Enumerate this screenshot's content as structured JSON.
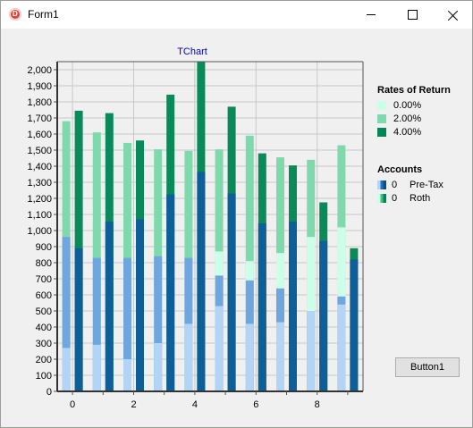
{
  "window": {
    "title": "Form1"
  },
  "button": {
    "label": "Button1"
  },
  "chart_title": "TChart",
  "legends": {
    "rates": {
      "title": "Rates of Return",
      "items": [
        {
          "label": "0.00%",
          "color": "#ccffe8"
        },
        {
          "label": "2.00%",
          "color": "#7fd9ad"
        },
        {
          "label": "4.00%",
          "color": "#008557"
        }
      ]
    },
    "accounts": {
      "title": "Accounts",
      "items": [
        {
          "value": "0",
          "label": "Pre-Tax",
          "colors": [
            "#b3d4f5",
            "#1c74c0",
            "#0a4e86"
          ]
        },
        {
          "value": "0",
          "label": "Roth",
          "colors": [
            "#ccffe8",
            "#3fbf86",
            "#008557"
          ]
        }
      ]
    }
  },
  "chart_data": {
    "type": "bar",
    "title": "TChart",
    "x": [
      0,
      1,
      2,
      3,
      4,
      5,
      6,
      7,
      8,
      9
    ],
    "x_ticks": [
      "0",
      "2",
      "4",
      "6",
      "8"
    ],
    "ylim": [
      0,
      2050
    ],
    "y_ticks": [
      "0",
      "100",
      "200",
      "300",
      "400",
      "500",
      "600",
      "700",
      "800",
      "900",
      "1,000",
      "1,100",
      "1,200",
      "1,300",
      "1,400",
      "1,500",
      "1,600",
      "1,700",
      "1,800",
      "1,900",
      "2,000"
    ],
    "grid": true,
    "legend_position": "right",
    "series": [
      {
        "name": "Pre-Tax 0.00%",
        "group": "light",
        "account": "pretax",
        "values": [
          270,
          290,
          200,
          300,
          420,
          530,
          420,
          430,
          500,
          540
        ]
      },
      {
        "name": "Pre-Tax 2.00%",
        "group": "light",
        "account": "pretax",
        "values": [
          960,
          830,
          830,
          840,
          830,
          720,
          690,
          640,
          500,
          590
        ]
      },
      {
        "name": "Pre-Tax 4.00%",
        "group": "dark",
        "account": "pretax",
        "values": [
          890,
          1055,
          1070,
          1225,
          1365,
          1230,
          1045,
          1055,
          935,
          820
        ]
      },
      {
        "name": "Roth 0.00%",
        "group": "light",
        "account": "roth",
        "values": [
          600,
          600,
          510,
          630,
          790,
          870,
          810,
          860,
          960,
          1020
        ]
      },
      {
        "name": "Roth 2.00%",
        "group": "light",
        "account": "roth",
        "values": [
          1680,
          1610,
          1545,
          1505,
          1495,
          1505,
          1590,
          1455,
          1440,
          1530
        ]
      },
      {
        "name": "Roth 4.00%",
        "group": "dark",
        "account": "roth",
        "values": [
          1745,
          1730,
          1560,
          1845,
          2050,
          1770,
          1480,
          1405,
          1175,
          890
        ]
      }
    ]
  }
}
